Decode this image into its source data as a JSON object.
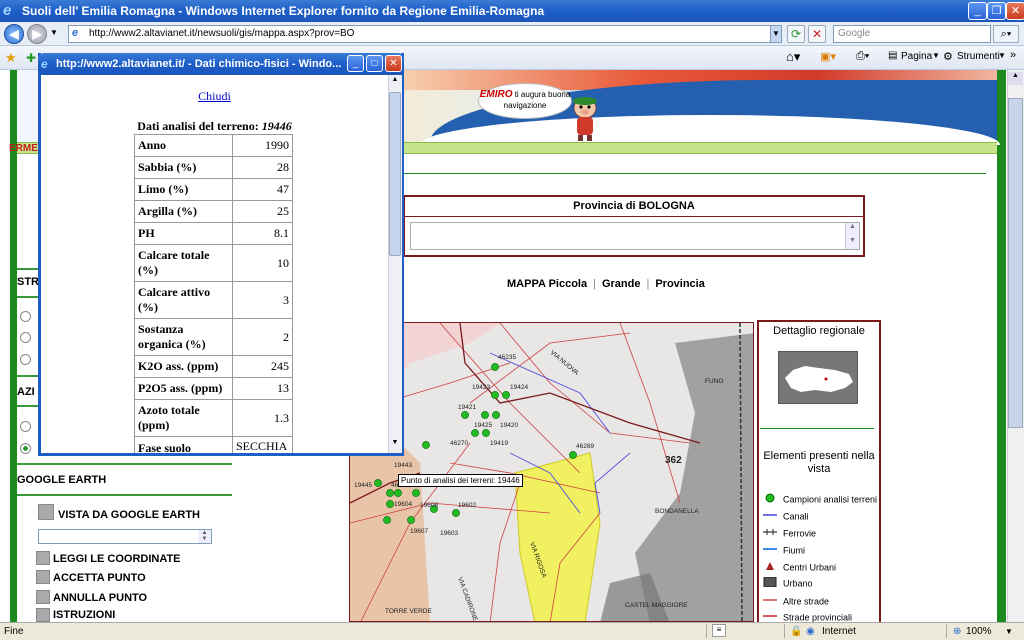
{
  "window": {
    "title": "Suoli dell' Emilia Romagna - Windows Internet Explorer fornito da Regione Emilia-Romagna"
  },
  "nav": {
    "url": "http://www2.altavianet.it/newsuoli/gis/mappa.aspx?prov=BO",
    "search_placeholder": "Google"
  },
  "commands": {
    "pagina": "Pagina",
    "strumenti": "Strumenti"
  },
  "banner": {
    "emiro": "EMIRO",
    "slogan": "ti augura buona navigazione"
  },
  "header_fragment": "ERME",
  "provincia": {
    "title": "Provincia di BOLOGNA"
  },
  "mappa": {
    "label": "MAPPA",
    "piccola": "Piccola",
    "grande": "Grande",
    "provincia": "Provincia"
  },
  "leftnav": {
    "str_fragment": "STR",
    "azi_fragment": "AZI",
    "google_earth": "GOOGLE EARTH",
    "vista": "VISTA DA GOOGLE EARTH",
    "leggi": "LEGGI LE COORDINATE",
    "accetta": "ACCETTA PUNTO",
    "annulla": "ANNULLA PUNTO",
    "istruzioni": "ISTRUZIONI"
  },
  "popup": {
    "title": "http://www2.altavianet.it/ - Dati chimico-fisici - Windo...",
    "close_link": "Chiudi",
    "heading": "Dati analisi del terreno: ",
    "sample_id": "19446",
    "rows": [
      {
        "k": "Anno",
        "v": "1990"
      },
      {
        "k": "Sabbia (%)",
        "v": "28"
      },
      {
        "k": "Limo (%)",
        "v": "47"
      },
      {
        "k": "Argilla (%)",
        "v": "25"
      },
      {
        "k": "PH",
        "v": "8.1"
      },
      {
        "k": "Calcare totale (%)",
        "v": "10"
      },
      {
        "k": "Calcare attivo (%)",
        "v": "3"
      },
      {
        "k": "Sostanza organica (%)",
        "v": "2"
      },
      {
        "k": "K2O ass. (ppm)",
        "v": "245"
      },
      {
        "k": "P2O5 ass. (ppm)",
        "v": "13"
      },
      {
        "k": "Azoto totale (ppm)",
        "v": "1.3"
      },
      {
        "k": "Fase suolo",
        "v": "SECCHIA"
      }
    ]
  },
  "map": {
    "tooltip": "Punto di analisi dei terreni: 19446",
    "labels": [
      "46235",
      "19423",
      "19424",
      "19421",
      "19425",
      "19420",
      "46270",
      "19419",
      "46289",
      "19443",
      "19445",
      "46300",
      "19604",
      "19606",
      "19602",
      "19607",
      "19603",
      "362",
      "BONDANELLA",
      "VIA RIGOSA",
      "VIA NUOVA",
      "FUNO",
      "TORRE VERDE",
      "CASTEL MAGGIORE",
      "VIA CADIRONE"
    ],
    "green": "#22bb22"
  },
  "panel": {
    "dettaglio": "Dettaglio regionale",
    "elementi": "Elementi presenti nella vista",
    "legend": [
      {
        "label": "Campioni analisi terreni",
        "sym": "dot",
        "color": "#22bb22"
      },
      {
        "label": "Canali",
        "sym": "line",
        "color": "#4444dd"
      },
      {
        "label": "Ferrovie",
        "sym": "rail",
        "color": "#333333"
      },
      {
        "label": "Fiumi",
        "sym": "line",
        "color": "#0066dd"
      },
      {
        "label": "Centri Urbani",
        "sym": "tri",
        "color": "#aa2222"
      },
      {
        "label": "Urbano",
        "sym": "box",
        "color": "#555555"
      },
      {
        "label": "Altre strade",
        "sym": "line",
        "color": "#dd4444"
      },
      {
        "label": "Strade provinciali",
        "sym": "line",
        "color": "#cc2222"
      }
    ]
  },
  "status": {
    "left": "Fine",
    "zone": "Internet",
    "zoom": "100%"
  }
}
